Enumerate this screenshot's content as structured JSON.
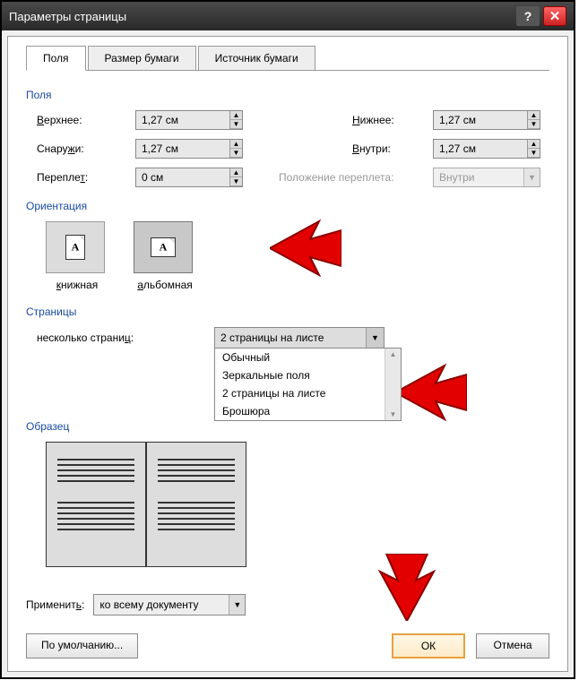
{
  "titlebar": {
    "title": "Параметры страницы"
  },
  "tabs": {
    "margins": "Поля",
    "paper": "Размер бумаги",
    "source": "Источник бумаги"
  },
  "section_margins": "Поля",
  "margins": {
    "top_label": "Верхнее:",
    "top_val": "1,27 см",
    "bottom_label": "Нижнее:",
    "bottom_val": "1,27 см",
    "outside_label": "Снаружи:",
    "outside_val": "1,27 см",
    "inside_label": "Внутри:",
    "inside_val": "1,27 см",
    "gutter_label": "Переплет:",
    "gutter_val": "0 см",
    "gutterpos_label": "Положение переплета:",
    "gutterpos_val": "Внутри"
  },
  "section_orient": "Ориентация",
  "orient": {
    "portrait": "книжная",
    "landscape": "альбомная"
  },
  "section_pages": "Страницы",
  "pages": {
    "label": "несколько страниц:",
    "selected": "2 страницы на листе",
    "options": [
      "Обычный",
      "Зеркальные поля",
      "2 страницы на листе",
      "Брошюра"
    ]
  },
  "section_preview": "Образец",
  "apply": {
    "label": "Применить:",
    "value": "ко всему документу"
  },
  "buttons": {
    "defaults": "По умолчанию...",
    "ok": "ОК",
    "cancel": "Отмена"
  }
}
